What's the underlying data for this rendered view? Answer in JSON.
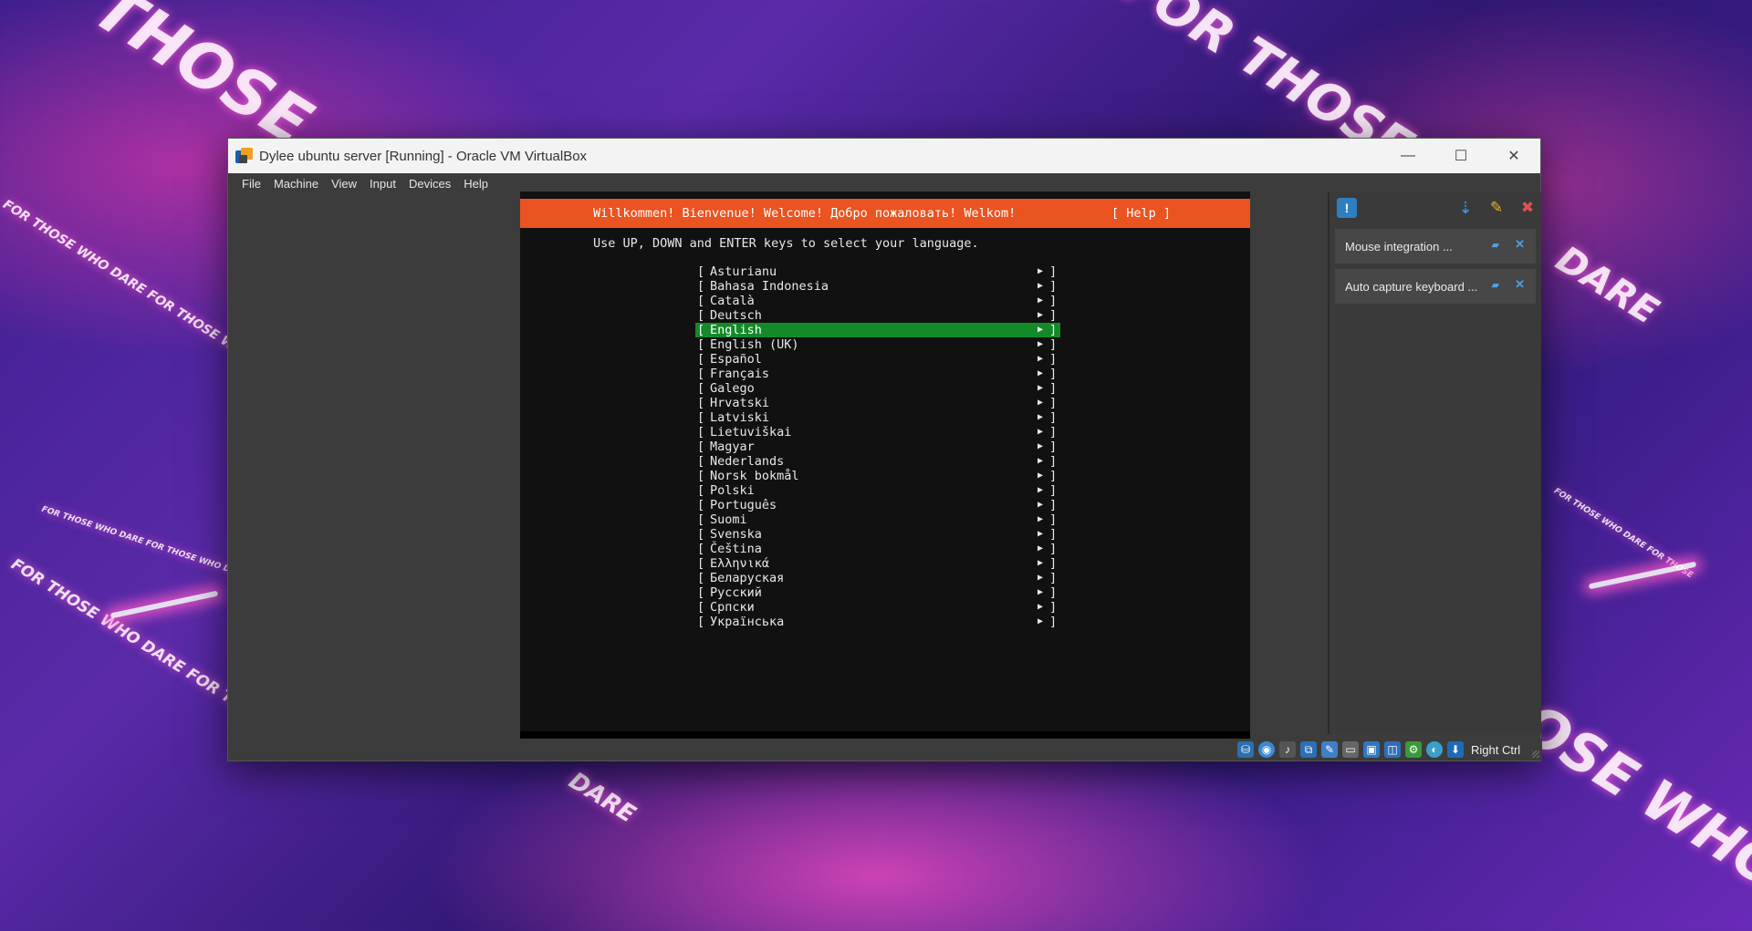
{
  "wallpaper": {
    "slogans": [
      "THOSE",
      "FOR THOSE",
      "FOR THOSE WHO DARE FOR THOSE WHO",
      "FOR THOSE WHO DARE FOR THOSE WHO DARE",
      "FOR THOSE WHO DARE FOR THO",
      "DARE",
      "DARE",
      "OSE WHO DA",
      "FOR THOSE WHO DARE FOR THOSE"
    ]
  },
  "window": {
    "title": "Dylee ubuntu server [Running] - Oracle VM VirtualBox",
    "controls": {
      "minimize": "—",
      "maximize": "☐",
      "close": "✕"
    },
    "menu": [
      "File",
      "Machine",
      "View",
      "Input",
      "Devices",
      "Help"
    ]
  },
  "installer": {
    "banner_welcome": "Willkommen! Bienvenue! Welcome! Добро пожаловать! Welkom!",
    "banner_help": "[ Help ]",
    "instruction": "Use UP, DOWN and ENTER keys to select your language.",
    "selected_index": 4,
    "languages": [
      "Asturianu",
      "Bahasa Indonesia",
      "Català",
      "Deutsch",
      "English",
      "English (UK)",
      "Español",
      "Français",
      "Galego",
      "Hrvatski",
      "Latviski",
      "Lietuviškai",
      "Magyar",
      "Nederlands",
      "Norsk bokmål",
      "Polski",
      "Português",
      "Suomi",
      "Svenska",
      "Čeština",
      "Ελληνικά",
      "Беларуская",
      "Русский",
      "Српски",
      "Українська"
    ],
    "bracket_left": "[",
    "bracket_right": "]",
    "arrow": "▶"
  },
  "notifications": {
    "items": [
      {
        "text": "Mouse integration ..."
      },
      {
        "text": "Auto capture keyboard ..."
      }
    ],
    "icons": [
      "notification-center-icon",
      "sort-icon",
      "accept-all-icon",
      "dismiss-all-icon"
    ],
    "accent": "#4aa3e8"
  },
  "statusbar": {
    "host_key": "Right Ctrl",
    "icons": [
      "hard-disk-icon",
      "optical-drive-icon",
      "audio-icon",
      "network-icon",
      "usb-icon",
      "shared-folders-icon",
      "display-icon",
      "recording-icon",
      "cpu-icon",
      "mouse-integration-icon",
      "keyboard-capture-icon"
    ]
  },
  "colors": {
    "ubuntu_orange": "#e95420",
    "selection_green": "#128a28",
    "terminal_bg": "#111111"
  }
}
